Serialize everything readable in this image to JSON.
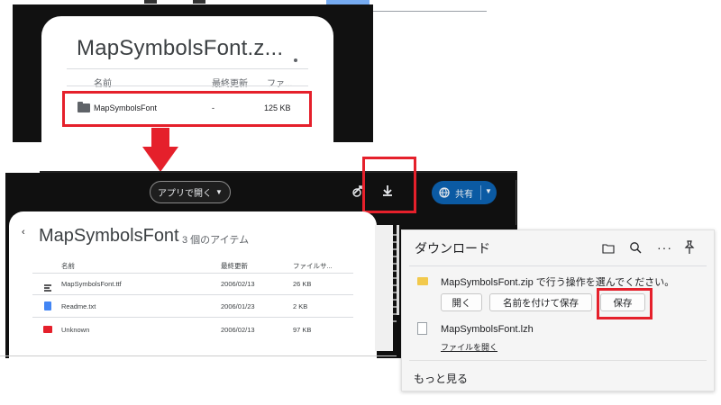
{
  "zip_preview": {
    "title": "MapSymbolsFont.z...",
    "columns": [
      "名前",
      "最終更新",
      "ファ..."
    ],
    "row": {
      "name": "MapSymbolsFont",
      "modified": "-",
      "size": "125 KB"
    }
  },
  "viewer_toolbar": {
    "open_with": "アプリで開く",
    "share": "共有"
  },
  "folder": {
    "title": "MapSymbolsFont",
    "count": "3 個のアイテム",
    "columns": [
      "名前",
      "最終更新",
      "ファイルサ..."
    ],
    "items": [
      {
        "name": "MapSymbolsFont.ttf",
        "modified": "2006/02/13",
        "size": "26 KB",
        "icon": "font-file-icon"
      },
      {
        "name": "Readme.txt",
        "modified": "2006/01/23",
        "size": "2 KB",
        "icon": "doc-file-icon"
      },
      {
        "name": "Unknown",
        "modified": "2006/02/13",
        "size": "97 KB",
        "icon": "pdf-file-icon"
      }
    ]
  },
  "download_pane": {
    "title": "ダウンロード",
    "zip_message": "MapSymbolsFont.zip で行う操作を選んでください。",
    "buttons": {
      "open": "開く",
      "save_as": "名前を付けて保存",
      "save": "保存"
    },
    "lzh_name": "MapSymbolsFont.lzh",
    "lzh_open": "ファイルを開く",
    "see_more": "もっと見る"
  },
  "colors": {
    "highlight": "#e5202b",
    "share_blue": "#0b5aa3",
    "dark_bg": "#101010"
  }
}
